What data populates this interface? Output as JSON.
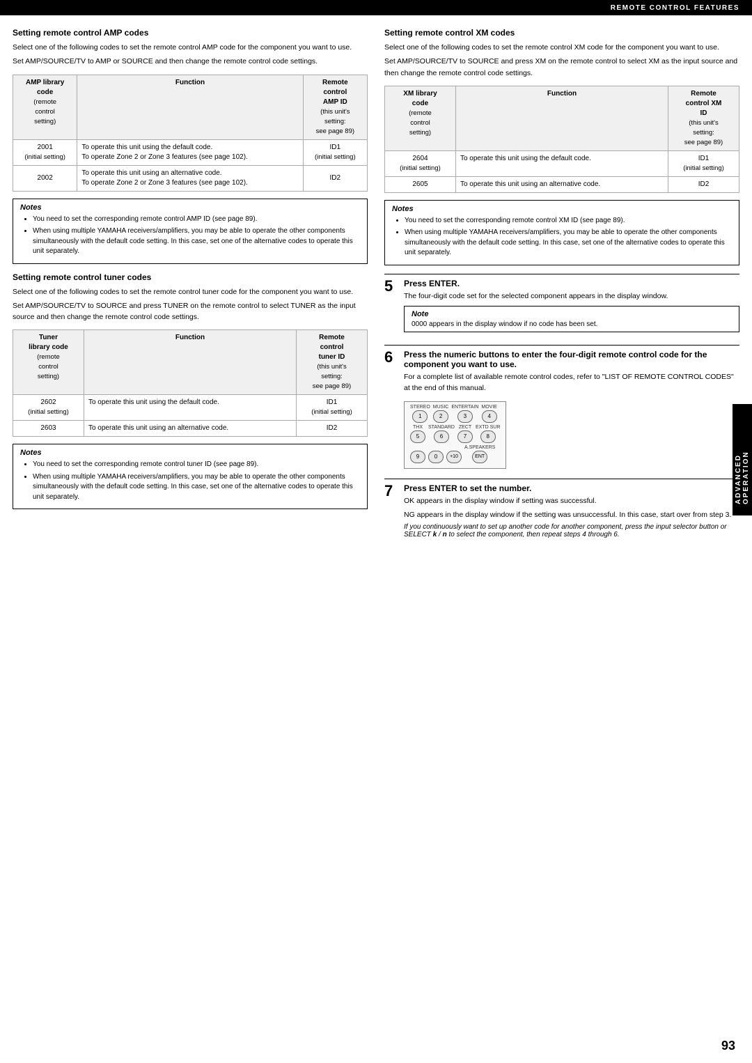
{
  "topBar": {
    "title": "REMOTE CONTROL FEATURES"
  },
  "pageNumber": "93",
  "sidebarTab": "ADVANCED OPERATION",
  "leftCol": {
    "section1": {
      "title": "Setting remote control AMP codes",
      "para1": "Select one of the following codes to set the remote control AMP code for the component you want to use.",
      "para2": "Set AMP/SOURCE/TV to AMP or SOURCE and then change the remote control code settings.",
      "table": {
        "headers": [
          "AMP library code (remote control setting)",
          "Function",
          "Remote control AMP ID (this unit's setting: see page 89)"
        ],
        "rows": [
          {
            "code": "2001\n(initial setting)",
            "function": "To operate this unit using the default code.\nTo operate Zone 2 or Zone 3 features (see page 102).",
            "id": "ID1\n(initial setting)"
          },
          {
            "code": "2002",
            "function": "To operate this unit using an alternative code.\nTo operate Zone 2 or Zone 3 features (see page 102).",
            "id": "ID2"
          }
        ]
      },
      "notes": {
        "title": "Notes",
        "items": [
          "You need to set the corresponding remote control AMP ID (see page 89).",
          "When using multiple YAMAHA receivers/amplifiers, you may be able to operate the other components simultaneously with the default code setting. In this case, set one of the alternative codes to operate this unit separately."
        ]
      }
    },
    "section2": {
      "title": "Setting remote control tuner codes",
      "para1": "Select one of the following codes to set the remote control tuner code for the component you want to use.",
      "para2": "Set AMP/SOURCE/TV to SOURCE and press TUNER on the remote control to select TUNER as the input source and then change the remote control code settings.",
      "table": {
        "headers": [
          "Tuner library code (remote control setting)",
          "Function",
          "Remote control tuner ID (this unit's setting: see page 89)"
        ],
        "rows": [
          {
            "code": "2602\n(initial setting)",
            "function": "To operate this unit using the default code.",
            "id": "ID1\n(initial setting)"
          },
          {
            "code": "2603",
            "function": "To operate this unit using an alternative code.",
            "id": "ID2"
          }
        ]
      },
      "notes": {
        "title": "Notes",
        "items": [
          "You need to set the corresponding remote control tuner ID (see page 89).",
          "When using multiple YAMAHA receivers/amplifiers, you may be able to operate the other components simultaneously with the default code setting. In this case, set one of the alternative codes to operate this unit separately."
        ]
      }
    }
  },
  "rightCol": {
    "section1": {
      "title": "Setting remote control XM codes",
      "para1": "Select one of the following codes to set the remote control XM code for the component you want to use.",
      "para2": "Set AMP/SOURCE/TV to SOURCE and press XM on the remote control to select XM as the input source and then change the remote control code settings.",
      "table": {
        "headers": [
          "XM library code (remote control setting)",
          "Function",
          "Remote control XM ID (this unit's setting: see page 89)"
        ],
        "rows": [
          {
            "code": "2604\n(initial setting)",
            "function": "To operate this unit using the default code.",
            "id": "ID1\n(initial setting)"
          },
          {
            "code": "2605",
            "function": "To operate this unit using an alternative code.",
            "id": "ID2"
          }
        ]
      },
      "notes": {
        "title": "Notes",
        "items": [
          "You need to set the corresponding remote control XM ID (see page 89).",
          "When using multiple YAMAHA receivers/amplifiers, you may be able to operate the other components simultaneously with the default code setting. In this case, set one of the alternative codes to operate this unit separately."
        ]
      }
    },
    "step5": {
      "num": "5",
      "title": "Press ENTER.",
      "body": "The four-digit code set for the selected component appears in the display window.",
      "note": {
        "title": "Note",
        "text": "0000 appears in the display window if no code has been set."
      }
    },
    "step6": {
      "num": "6",
      "title": "Press the numeric buttons to enter the four-digit remote control code for the component you want to use.",
      "body": "For a complete list of available remote control codes, refer to \"LIST OF REMOTE CONTROL CODES\" at the end of this manual.",
      "keypad": {
        "rows": [
          [
            {
              "label": "STEREO",
              "key": "1"
            },
            {
              "label": "MUSIC",
              "key": "2"
            },
            {
              "label": "ENTERTAIN",
              "key": "3"
            },
            {
              "label": "MOVIE",
              "key": "4"
            }
          ],
          [
            {
              "label": "THX",
              "key": "5"
            },
            {
              "label": "STANDARD",
              "key": "6"
            },
            {
              "label": "ZECT",
              "key": "7"
            },
            {
              "label": "EXTD SUR",
              "key": "8"
            }
          ],
          [
            {
              "label": "",
              "key": "9"
            },
            {
              "label": "",
              "key": "0"
            },
            {
              "label": "",
              "key": "+10"
            },
            {
              "label": "A.SPEAKERS",
              "key": "ENT"
            }
          ]
        ]
      }
    },
    "step7": {
      "num": "7",
      "title": "Press ENTER to set the number.",
      "body1": "OK appears in the display window if setting was successful.",
      "body2": "NG appears in the display window if the setting was unsuccessful. In this case, start over from step 3.",
      "italic": "If you continuously want to set up another code for another component, press the input selector button or SELECT k / n to select the component, then repeat steps 4 through 6."
    }
  }
}
